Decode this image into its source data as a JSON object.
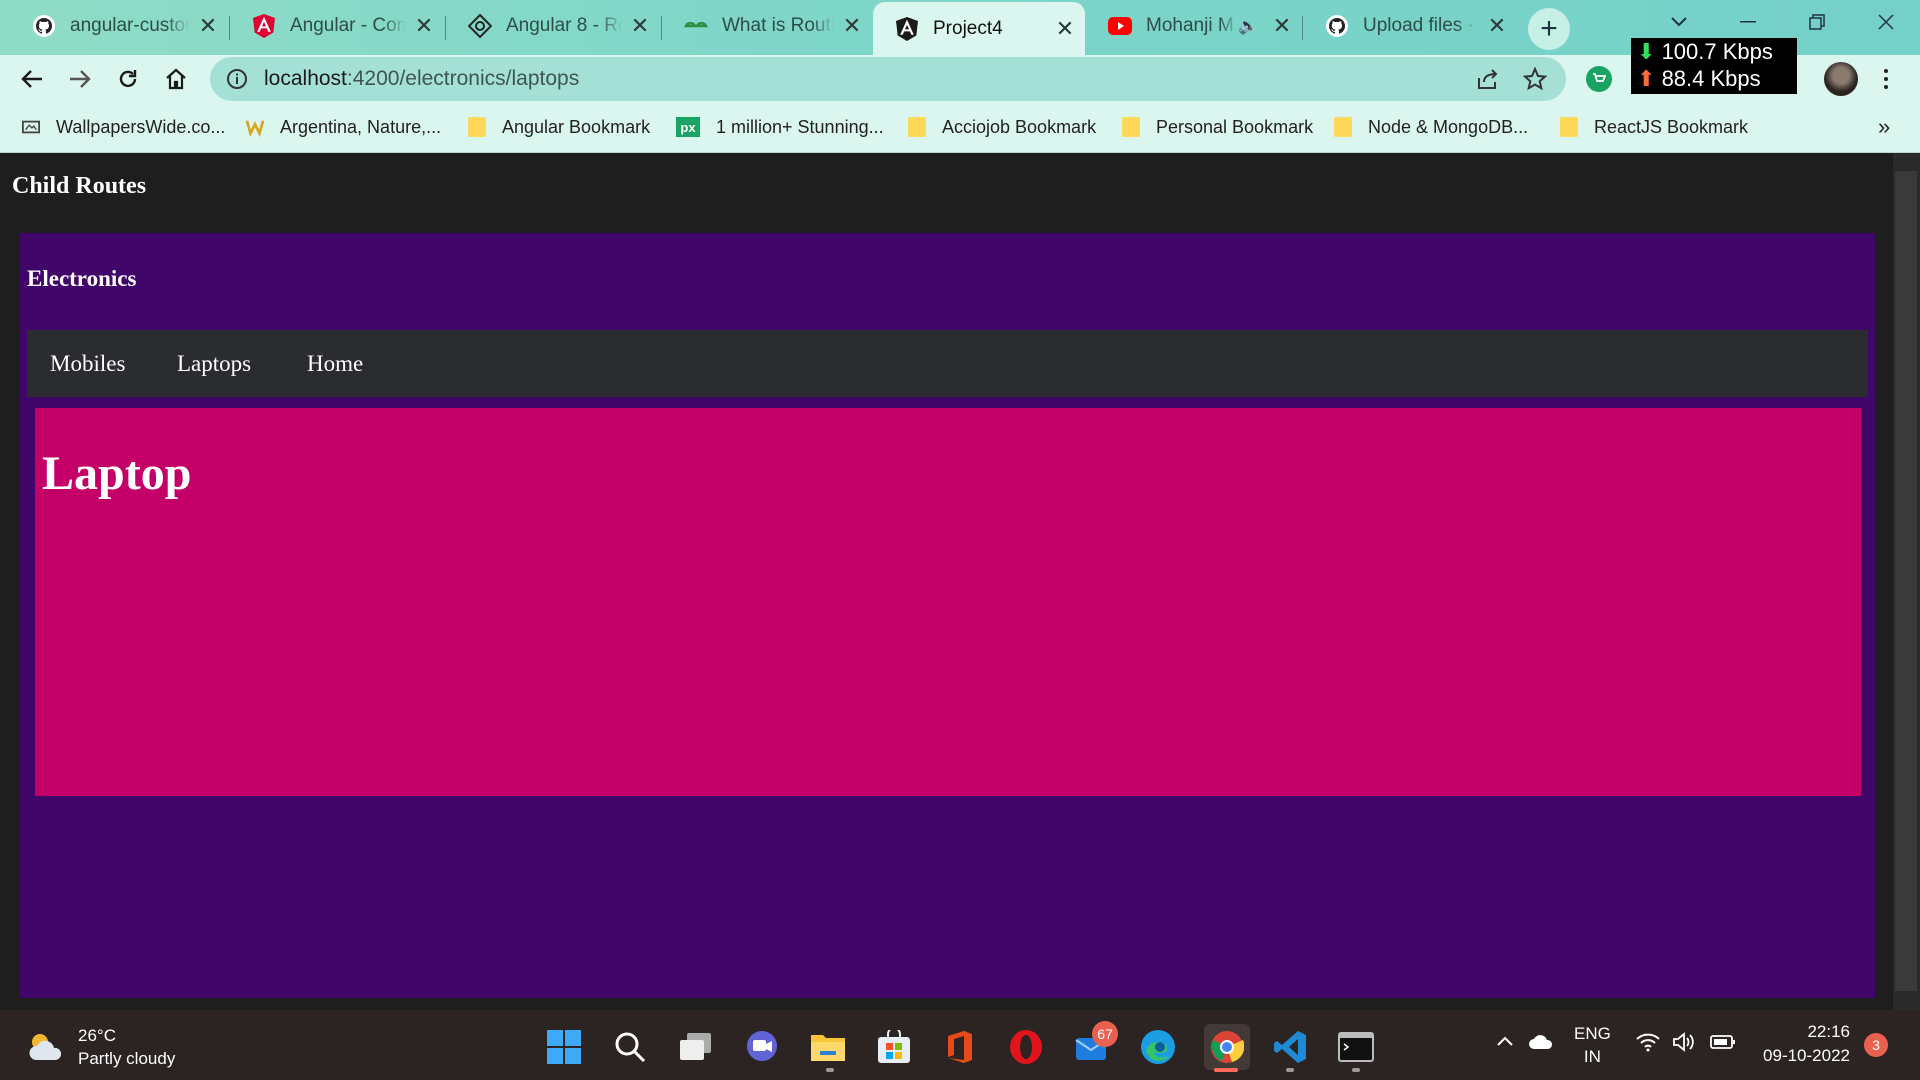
{
  "browser": {
    "tabs": [
      {
        "title": "angular-custom",
        "icon": "github-icon"
      },
      {
        "title": "Angular - Com",
        "icon": "angular-icon"
      },
      {
        "title": "Angular 8 - Ro",
        "icon": "web-icon"
      },
      {
        "title": "What is Routin",
        "icon": "geeksforgeeks-icon"
      },
      {
        "title": "Project4",
        "icon": "angular-icon",
        "active": true
      },
      {
        "title": "Mohanji M",
        "icon": "youtube-icon",
        "audio": true
      },
      {
        "title": "Upload files · A",
        "icon": "github-icon"
      }
    ],
    "url_host": "localhost",
    "url_path": ":4200/electronics/laptops",
    "net_down": "100.7 Kbps",
    "net_up": "88.4 Kbps",
    "bookmarks": [
      {
        "label": "WallpapersWide.co..."
      },
      {
        "label": "Argentina, Nature,..."
      },
      {
        "label": "Angular Bookmark"
      },
      {
        "label": "1 million+ Stunning..."
      },
      {
        "label": "Acciojob Bookmark"
      },
      {
        "label": "Personal Bookmark"
      },
      {
        "label": "Node & MongoDB..."
      },
      {
        "label": "ReactJS Bookmark"
      }
    ],
    "bookmarks_overflow": "»"
  },
  "page": {
    "app_title": "Child Routes",
    "section_title": "Electronics",
    "nav_links": [
      "Mobiles",
      "Laptops",
      "Home"
    ],
    "content_heading": "Laptop"
  },
  "taskbar": {
    "temperature": "26°C",
    "weather": "Partly cloudy",
    "mail_badge": "67",
    "language": "ENG",
    "region": "IN",
    "time": "22:16",
    "date": "09-10-2022",
    "notifications": "3"
  },
  "colors": {
    "tabstrip": "#7fd6c8",
    "toolbar": "#daf6ef",
    "page_bg": "#1e1e1e",
    "electronics_bg": "#41066a",
    "subnav_bg": "#2a2c30",
    "laptop_bg": "#c40068"
  }
}
